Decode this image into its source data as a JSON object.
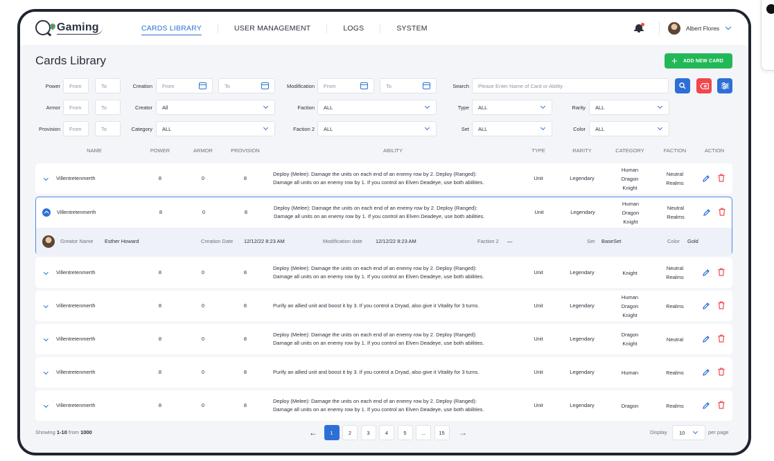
{
  "app": {
    "brand": "Gaming"
  },
  "nav": {
    "links": [
      "CARDS LIBRARY",
      "USER MANAGEMENT",
      "LOGS",
      "SYSTEM"
    ],
    "active": "CARDS LIBRARY",
    "user_name": "Albert Flores"
  },
  "page": {
    "title": "Cards Library",
    "add_button": "ADD NEW CARD"
  },
  "filters": {
    "power_label": "Power",
    "power_from": "From",
    "power_to": "To",
    "creation_label": "Creation",
    "creation_from": "From",
    "creation_to": "To",
    "modification_label": "Modification",
    "modification_from": "From",
    "modification_to": "To",
    "search_label": "Search",
    "search_placeholder": "Please Enter Name of Card or Ability",
    "armor_label": "Armor",
    "armor_from": "From",
    "armor_to": "To",
    "creator_label": "Creator",
    "creator_value": "All",
    "faction_label": "Faction",
    "faction_value": "ALL",
    "type_label": "Type",
    "type_value": "ALL",
    "rarity_label": "Rarity",
    "rarity_value": "ALL",
    "provision_label": "Provision",
    "provision_from": "From",
    "provision_to": "To",
    "category_label": "Category",
    "category_value": "ALL",
    "faction2_label": "Faction 2",
    "faction2_value": "ALL",
    "set_label": "Set",
    "set_value": "ALL",
    "color_label": "Color",
    "color_value": "ALL"
  },
  "table": {
    "headers": [
      "NAME",
      "POWER",
      "ARMOR",
      "PROVISION",
      "ABILITY",
      "TYPE",
      "RARITY",
      "CATEGORY",
      "FACTION",
      "ACTION"
    ],
    "rows": [
      {
        "name": "Villentretenmerth",
        "power": "8",
        "armor": "0",
        "provision": "8",
        "ability_1": "Deploy (Melee): Damage the units on each end of an enemy row by 2. Deploy (Ranged):",
        "ability_2": "Damage all units on an enemy row by 1. If you control an Elven Deadeye, use both abilities.",
        "type": "Unit",
        "rarity": "Legendary",
        "category_1": "Human",
        "category_2": "Dragon",
        "category_3": "Knight",
        "faction_1": "Neutral",
        "faction_2": "Realms"
      },
      {
        "name": "Villentretenmerth",
        "power": "8",
        "armor": "0",
        "provision": "8",
        "ability_1": "Deploy (Melee): Damage the units on each end of an enemy row by 2. Deploy (Ranged):",
        "ability_2": "Damage all units on an enemy row by 1. If you control an Elven Deadeye, use both abilities.",
        "type": "Unit",
        "rarity": "Legendary",
        "category_1": "Human",
        "category_2": "Dragon",
        "category_3": "Knight",
        "faction_1": "Neutral",
        "faction_2": "Realms",
        "detail": {
          "creator_label": "Greator Name",
          "creator_value": "Esther Howard",
          "creation_label": "Creation Date",
          "creation_value": "12/12/22 8:23 AM",
          "modification_label": "Modification date",
          "modification_value": "12/12/22 8:23 AM",
          "faction2_label": "Faction 2",
          "faction2_value": "—",
          "set_label": "Set",
          "set_value": "BaseSet",
          "color_label": "Color",
          "color_value": "Gold"
        }
      },
      {
        "name": "Villentretenmerth",
        "power": "8",
        "armor": "0",
        "provision": "8",
        "ability_1": "Deploy (Melee): Damage the units on each end of an enemy row by 2. Deploy (Ranged):",
        "ability_2": "Damage all units on an enemy row by 1. If you control an Elven Deadeye, use both abilities.",
        "type": "Unit",
        "rarity": "Legendary",
        "category_1": "Knight",
        "category_2": "",
        "category_3": "",
        "faction_1": "Neutral",
        "faction_2": "Realms"
      },
      {
        "name": "Villentretenmerth",
        "power": "8",
        "armor": "0",
        "provision": "8",
        "ability_1": "Purify an allied unit and boost it by 3. If you control a Dryad, also give it Vitality for 3 turns.",
        "ability_2": "",
        "type": "Unit",
        "rarity": "Legendary",
        "category_1": "Human",
        "category_2": "Dragon",
        "category_3": "Knight",
        "faction_1": "Realms",
        "faction_2": ""
      },
      {
        "name": "Villentretenmerth",
        "power": "8",
        "armor": "0",
        "provision": "8",
        "ability_1": "Deploy (Melee): Damage the units on each end of an enemy row by 2. Deploy (Ranged):",
        "ability_2": "Damage all units on an enemy row by 1. If you control an Elven Deadeye, use both abilities.",
        "type": "Unit",
        "rarity": "Legendary",
        "category_1": "Dragon",
        "category_2": "Knight",
        "category_3": "",
        "faction_1": "Neutral",
        "faction_2": ""
      },
      {
        "name": "Villentretenmerth",
        "power": "8",
        "armor": "0",
        "provision": "8",
        "ability_1": "Purify an allied unit and boost it by 3. If you control a Dryad, also give it Vitality for 3 turns.",
        "ability_2": "",
        "type": "Unit",
        "rarity": "Legendary",
        "category_1": "Human",
        "category_2": "",
        "category_3": "",
        "faction_1": "Realms",
        "faction_2": ""
      },
      {
        "name": "Villentretenmerth",
        "power": "8",
        "armor": "0",
        "provision": "8",
        "ability_1": "Deploy (Melee): Damage the units on each end of an enemy row by 2. Deploy (Ranged):",
        "ability_2": "Damage all units on an enemy row by 1. If you control an Elven Deadeye, use both abilities.",
        "type": "Unit",
        "rarity": "Legendary",
        "category_1": "Dragon",
        "category_2": "",
        "category_3": "",
        "faction_1": "Realms",
        "faction_2": ""
      }
    ]
  },
  "footer": {
    "showing_prefix": "Showing",
    "showing_range": "1-10",
    "showing_mid": "from",
    "showing_total": "1000",
    "pages": [
      "1",
      "2",
      "3",
      "4",
      "5",
      "...",
      "15"
    ],
    "current_page": "1",
    "display_label": "Display",
    "display_value": "10",
    "per_page": "per page"
  },
  "colors": {
    "primary": "#2d6fd6",
    "success": "#22b857",
    "danger": "#f0474d",
    "background": "#f4f5f8"
  },
  "icons": [
    "search-icon",
    "clear-filter-icon",
    "filter-settings-icon",
    "calendar-icon",
    "bell-icon",
    "edit-icon",
    "delete-icon",
    "chevron-down-icon"
  ]
}
